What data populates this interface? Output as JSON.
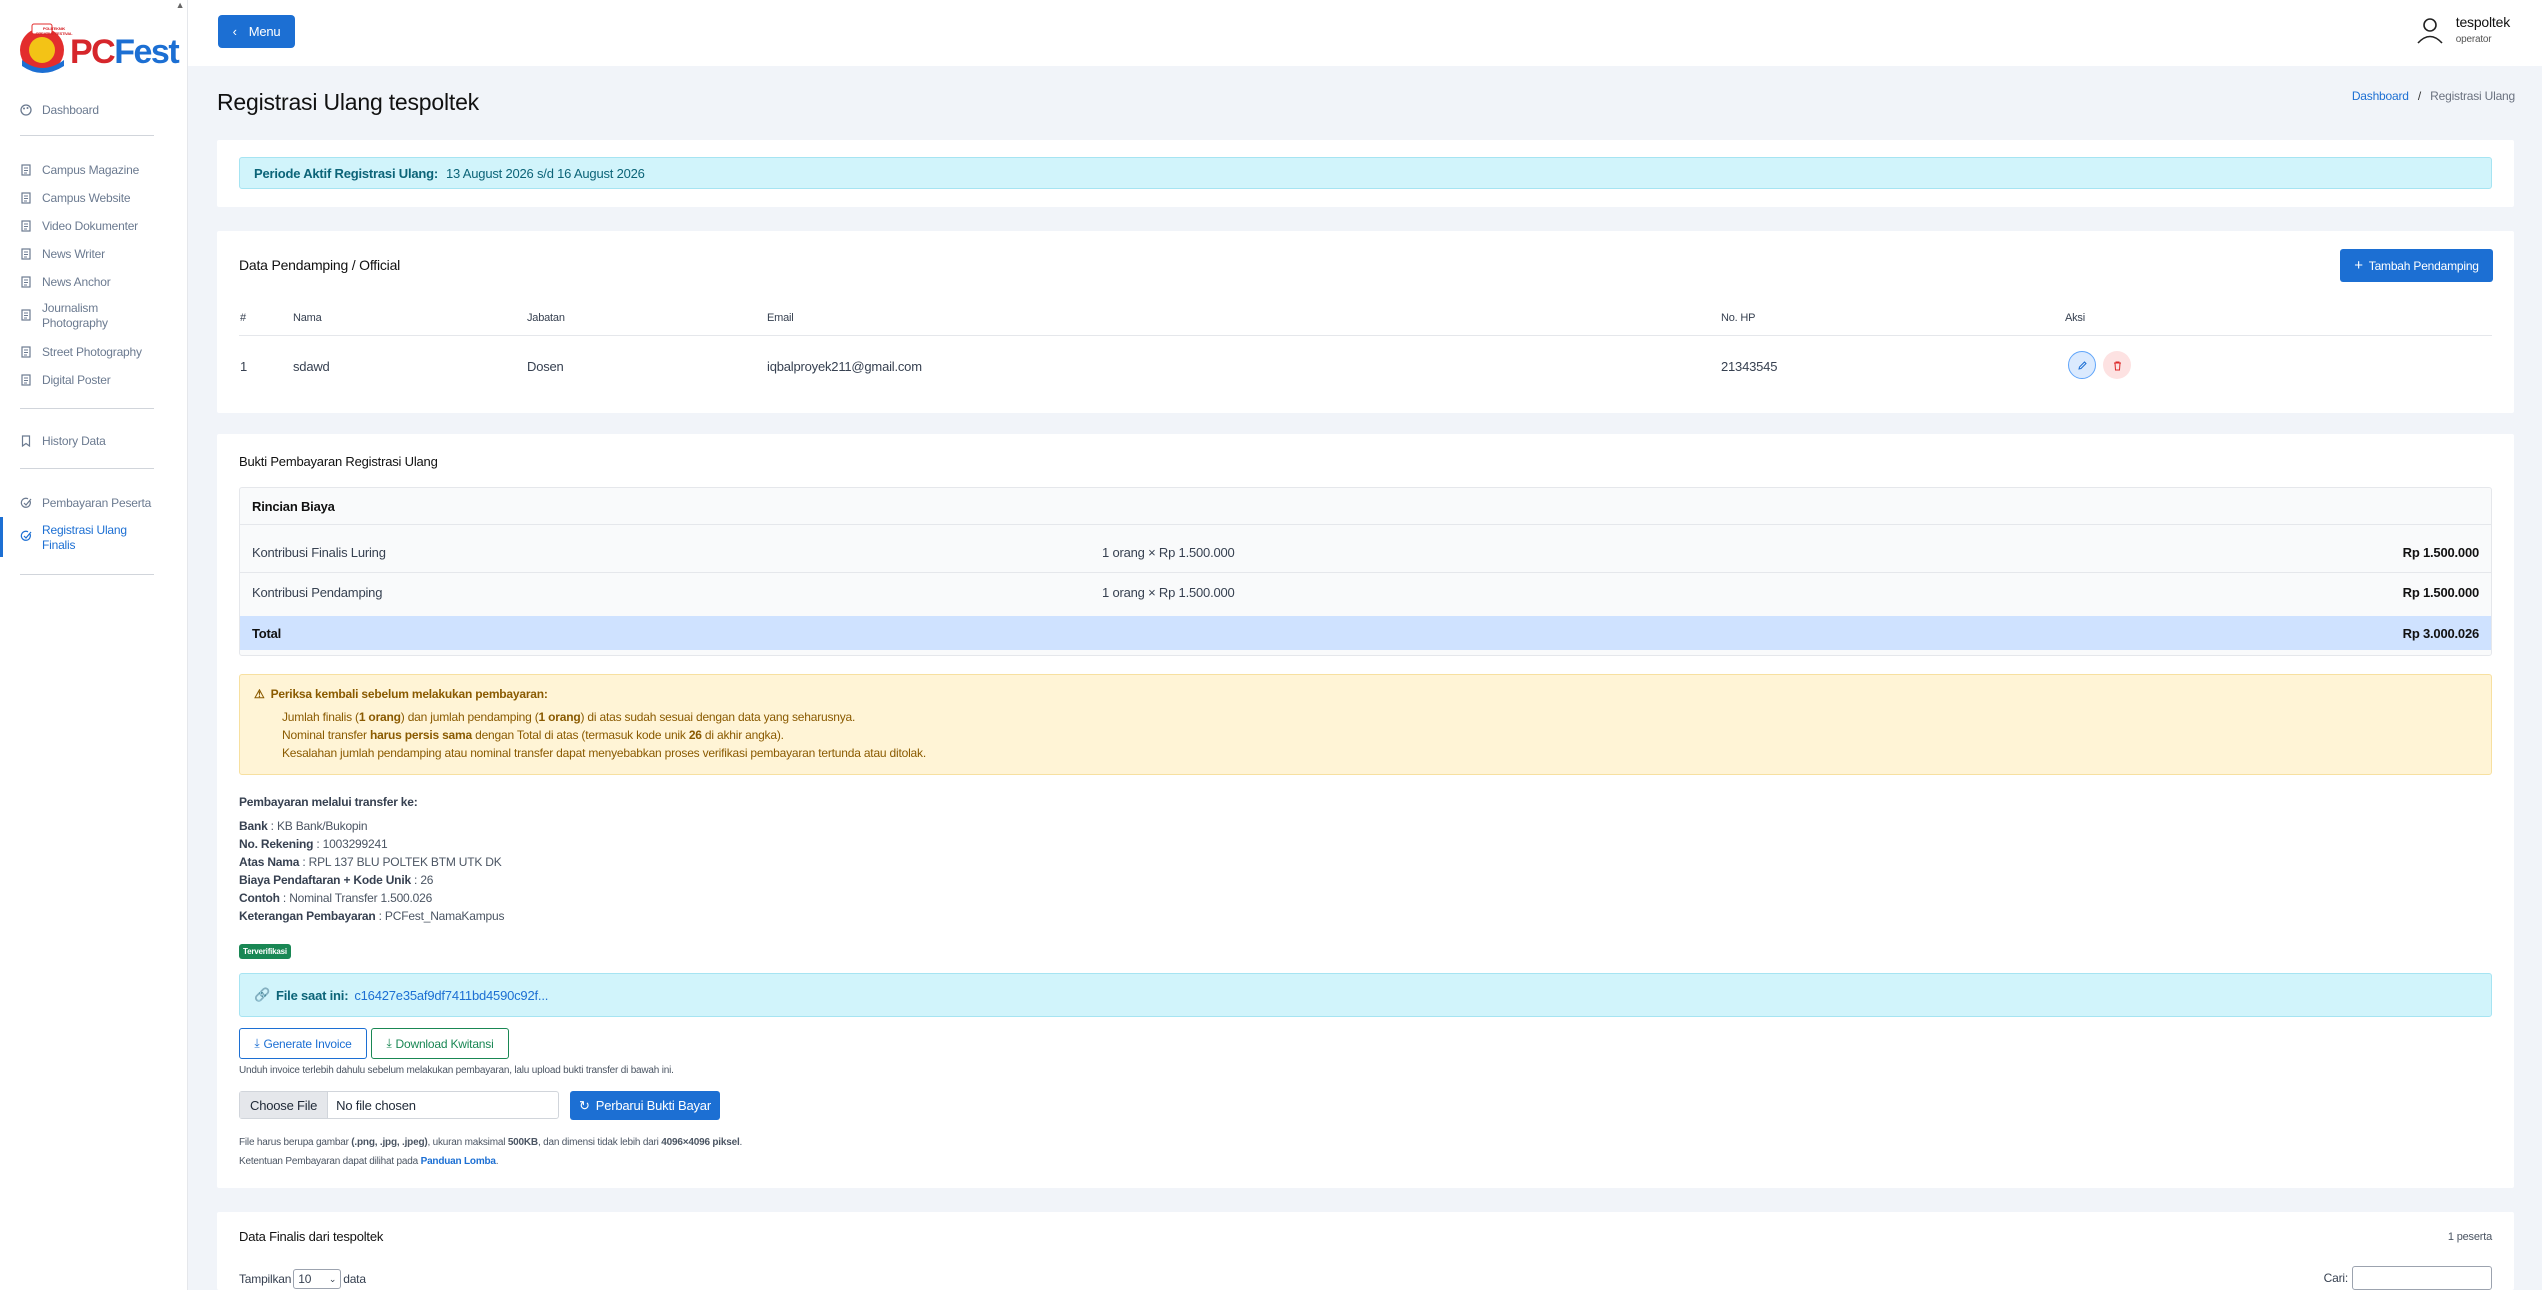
{
  "sidebar": {
    "logo": {
      "small_text": "POLITEKNIK CREATIVE FESTIVAL",
      "main_pc": "PC",
      "main_fest": "Fest"
    },
    "groups": [
      {
        "items": [
          {
            "label": "Dashboard",
            "icon": "palette-icon"
          }
        ]
      },
      {
        "items": [
          {
            "label": "Campus Magazine",
            "icon": "document-icon"
          },
          {
            "label": "Campus Website",
            "icon": "document-icon"
          },
          {
            "label": "Video Dokumenter",
            "icon": "document-icon"
          },
          {
            "label": "News Writer",
            "icon": "document-icon"
          },
          {
            "label": "News Anchor",
            "icon": "document-icon"
          },
          {
            "label": "Journalism Photography",
            "icon": "document-icon"
          },
          {
            "label": "Street Photography",
            "icon": "document-icon"
          },
          {
            "label": "Digital Poster",
            "icon": "document-icon"
          }
        ]
      },
      {
        "items": [
          {
            "label": "History Data",
            "icon": "bookmark-icon"
          }
        ]
      },
      {
        "items": [
          {
            "label": "Pembayaran Peserta",
            "icon": "check-badge-icon"
          },
          {
            "label": "Registrasi Ulang Finalis",
            "icon": "check-badge-icon",
            "active": true
          }
        ]
      }
    ]
  },
  "topbar": {
    "menu_label": "Menu",
    "user_name": "tespoltek",
    "user_role": "operator"
  },
  "page": {
    "title": "Registrasi Ulang tespoltek",
    "breadcrumb": {
      "home": "Dashboard",
      "sep": "/",
      "current": "Registrasi Ulang"
    }
  },
  "periode": {
    "label": "Periode Aktif Registrasi Ulang:",
    "value": "13 August 2026 s/d 16 August 2026"
  },
  "pendamping": {
    "title": "Data Pendamping / Official",
    "add_button": "Tambah Pendamping",
    "columns": [
      "#",
      "Nama",
      "Jabatan",
      "Email",
      "No. HP",
      "Aksi"
    ],
    "rows": [
      {
        "no": "1",
        "nama": "sdawd",
        "jabatan": "Dosen",
        "email": "iqbalproyek211@gmail.com",
        "hp": "21343545"
      }
    ]
  },
  "bukti": {
    "title": "Bukti Pembayaran Registrasi Ulang",
    "rincian_title": "Rincian Biaya",
    "rows": [
      {
        "label": "Kontribusi Finalis Luring",
        "qty": "1 orang × Rp 1.500.000",
        "amount": "Rp 1.500.000"
      },
      {
        "label": "Kontribusi Pendamping",
        "qty": "1 orang × Rp 1.500.000",
        "amount": "Rp 1.500.000"
      }
    ],
    "total_label": "Total",
    "total_value": "Rp 3.000.026",
    "warning": {
      "title": "Periksa kembali sebelum melakukan pembayaran:",
      "l1a": "Jumlah finalis (",
      "l1b": "1 orang",
      "l1c": ") dan jumlah pendamping (",
      "l1d": "1 orang",
      "l1e": ") di atas sudah sesuai dengan data yang seharusnya.",
      "l2a": "Nominal transfer ",
      "l2b": "harus persis sama",
      "l2c": " dengan Total di atas (termasuk kode unik ",
      "l2d": "26",
      "l2e": " di akhir angka).",
      "l3": "Kesalahan jumlah pendamping atau nominal transfer dapat menyebabkan proses verifikasi pembayaran tertunda atau ditolak."
    },
    "transfer": {
      "heading": "Pembayaran melalui transfer ke:",
      "lines": [
        {
          "k": "Bank",
          "v": " : KB Bank/Bukopin"
        },
        {
          "k": "No. Rekening",
          "v": " : 1003299241"
        },
        {
          "k": "Atas Nama",
          "v": " : RPL 137 BLU POLTEK BTM UTK DK"
        },
        {
          "k": "Biaya Pendaftaran + Kode Unik",
          "v": " : 26"
        },
        {
          "k": "Contoh",
          "v": " : Nominal Transfer 1.500.026"
        },
        {
          "k": "Keterangan Pembayaran",
          "v": " : PCFest_NamaKampus"
        }
      ]
    },
    "badge": "Terverifikasi",
    "file_label": "File saat ini:",
    "file_name": "c16427e35af9df7411bd4590c92f...",
    "generate_invoice": "Generate Invoice",
    "download_kwitansi": "Download Kwitansi",
    "hint": "Unduh invoice terlebih dahulu sebelum melakukan pembayaran, lalu upload bukti transfer di bawah ini.",
    "choose_file": "Choose File",
    "no_file": "No file chosen",
    "update_button": "Perbarui Bukti Bayar",
    "note1a": "File harus berupa gambar ",
    "note1b": "(.png, .jpg, .jpeg)",
    "note1c": ", ukuran maksimal ",
    "note1d": "500KB",
    "note1e": ", dan dimensi tidak lebih dari ",
    "note1f": "4096×4096 piksel",
    "note1g": ".",
    "note2a": "Ketentuan Pembayaran dapat dilihat pada ",
    "note2b": "Panduan Lomba",
    "note2c": "."
  },
  "finalis": {
    "title": "Data Finalis dari tespoltek",
    "count": "1 peserta",
    "show_label": "Tampilkan",
    "show_value": "10",
    "data_label": "data",
    "search_label": "Cari:"
  },
  "colors": {
    "primary": "#1c6fd3",
    "info_bg": "#d1f4fb",
    "warn_bg": "#fff4d6",
    "success": "#198754"
  }
}
